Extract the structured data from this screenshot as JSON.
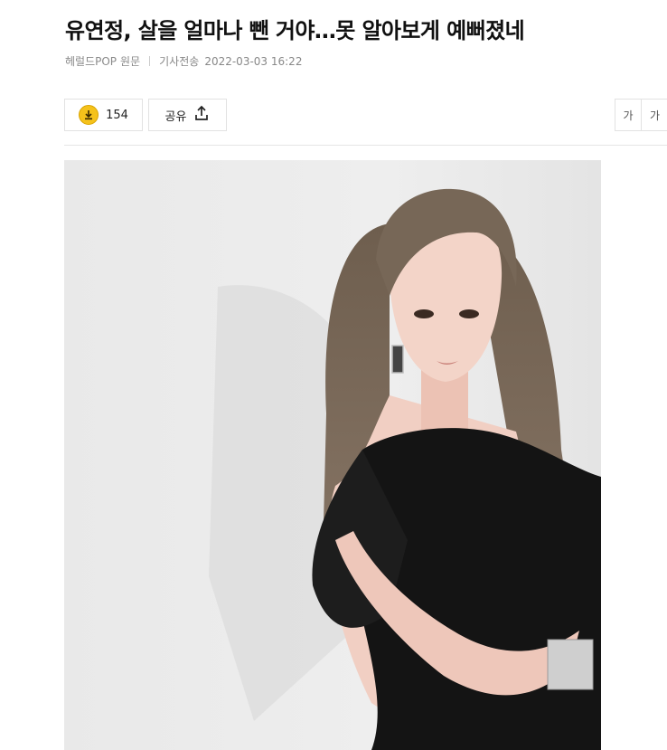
{
  "article": {
    "headline": "유연정, 살을 얼마나 뺀 거야…못 알아보게 예뻐졌네",
    "press": "헤럴드POP",
    "origin_label": "원문",
    "sent_label": "기사전송",
    "datetime": "2022-03-03 16:22"
  },
  "toolbar": {
    "reaction_count": "154",
    "share_label": "공유",
    "font_small": "가",
    "font_large": "가"
  },
  "icons": {
    "reaction": "emoji-coin-icon",
    "share": "share-upload-icon"
  },
  "colors": {
    "coin": "#f5c21b",
    "dress": "#141414",
    "background_wall": "#ebebeb"
  }
}
